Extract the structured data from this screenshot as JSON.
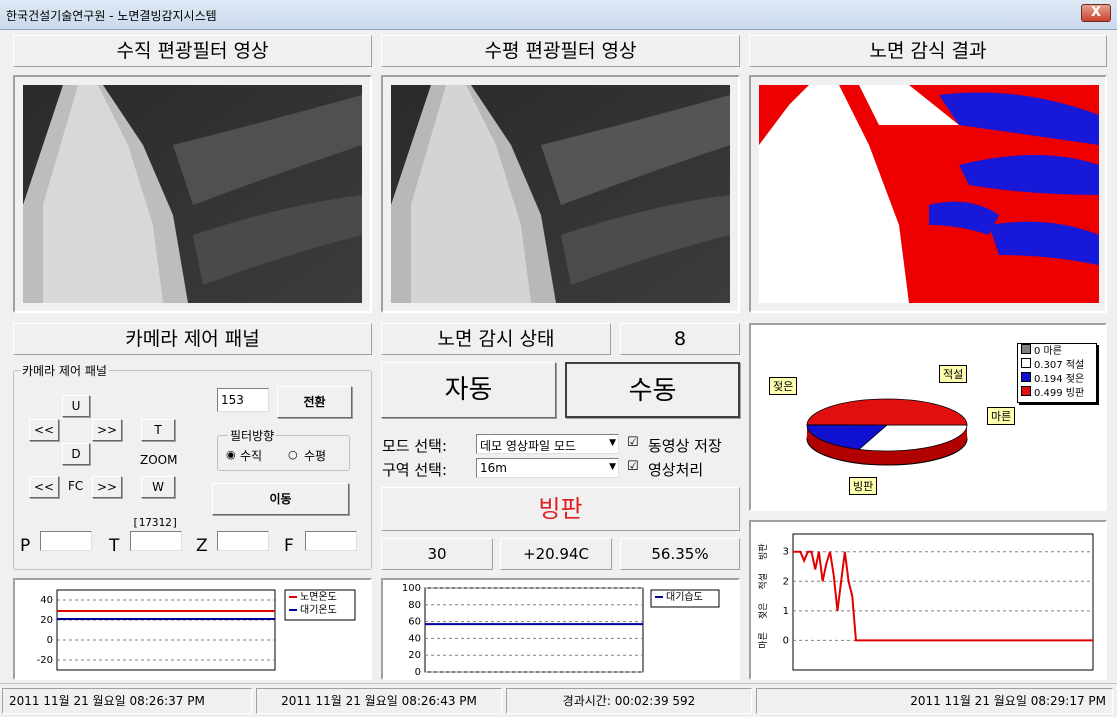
{
  "window": {
    "title": "한국건설기술연구원 - 노면결빙감지시스템",
    "close_label": "X"
  },
  "panels": {
    "vertical_title": "수직 편광필터 영상",
    "horizontal_title": "수평 편광필터 영상",
    "result_title": "노면 감식 결과",
    "camera_title": "카메라 제어 패널",
    "status_title": "노면 감시 상태",
    "status_count": "8"
  },
  "camera": {
    "group_label": "카메라 제어 패널",
    "up": "U",
    "down": "D",
    "left": "<<",
    "right": ">>",
    "tilt": "T",
    "zoom_label": "ZOOM",
    "wide": "W",
    "fc_left": "<<",
    "fc_label": "FC",
    "fc_right": ">>",
    "preset_value": "153",
    "switch_label": "전환",
    "filter_group": "필터방향",
    "filter_vertical": "수직",
    "filter_horizontal": "수평",
    "move_label": "이동",
    "t_readout": "[17312]",
    "p_label": "P",
    "t_label": "T",
    "z_label": "Z",
    "f_label": "F"
  },
  "mode": {
    "auto_label": "자동",
    "manual_label": "수동",
    "mode_label": "모드 선택:",
    "mode_value": "데모 영상파일 모드",
    "area_label": "구역 선택:",
    "area_value": "16m",
    "save_video": "동영상 저장",
    "image_proc": "영상처리",
    "result_text": "빙판",
    "result_color": "#e02020"
  },
  "readings": {
    "count": "30",
    "temperature": "+20.94C",
    "humidity": "56.35%"
  },
  "pie": {
    "legend": [
      {
        "value": "0",
        "name": "마른",
        "color": "#808080"
      },
      {
        "value": "0.307",
        "name": "적설",
        "color": "#ffffff"
      },
      {
        "value": "0.194",
        "name": "젖은",
        "color": "#1010d0"
      },
      {
        "value": "0.499",
        "name": "빙판",
        "color": "#e01010"
      }
    ],
    "callout_wet": "젖은",
    "callout_snow": "적설",
    "callout_dry": "마른",
    "callout_ice": "빙판"
  },
  "chart_data": [
    {
      "type": "line",
      "title": "",
      "ylim": [
        -30,
        50
      ],
      "yticks": [
        "40",
        "20",
        "0",
        "-20"
      ],
      "series": [
        {
          "name": "노면온도",
          "values": [
            29,
            29
          ],
          "color": "#e00000"
        },
        {
          "name": "대기온도",
          "values": [
            21,
            21
          ],
          "color": "#0000a0"
        }
      ]
    },
    {
      "type": "line",
      "title": "",
      "ylim": [
        0,
        100
      ],
      "yticks": [
        "100",
        "80",
        "60",
        "40",
        "20",
        "0"
      ],
      "series": [
        {
          "name": "대기습도",
          "values": [
            57,
            57
          ],
          "color": "#0000a0"
        }
      ]
    },
    {
      "type": "line",
      "title": "",
      "ylim": [
        -1,
        3.6
      ],
      "yticks": [
        "3",
        "2",
        "1",
        "0"
      ],
      "ylabels": [
        "빙판",
        "적설",
        "젖은",
        "마른"
      ],
      "series": [
        {
          "name": "",
          "values": [
            3,
            3,
            3,
            2.7,
            3,
            3,
            2.4,
            3,
            2,
            2.6,
            3,
            2.2,
            1,
            2,
            3,
            2,
            1.5,
            0,
            0,
            0,
            0,
            0,
            0,
            0,
            0,
            0,
            0,
            0,
            0,
            0,
            0,
            0,
            0,
            0,
            0,
            0,
            0,
            0,
            0,
            0,
            0,
            0,
            0,
            0,
            0,
            0,
            0,
            0,
            0,
            0,
            0,
            0,
            0,
            0,
            0,
            0,
            0,
            0,
            0,
            0,
            0,
            0,
            0,
            0,
            0,
            0,
            0,
            0,
            0,
            0,
            0,
            0,
            0,
            0,
            0,
            0,
            0,
            0,
            0,
            0,
            0,
            0
          ],
          "color": "#e00000"
        }
      ]
    }
  ],
  "status": {
    "start_time": "2011 11월 21 월요일 08:26:37 PM",
    "last_time": "2011 11월 21 월요일 08:26:43 PM",
    "elapsed": "경과시간: 00:02:39 592",
    "now": "2011 11월 21 월요일 08:29:17 PM"
  }
}
